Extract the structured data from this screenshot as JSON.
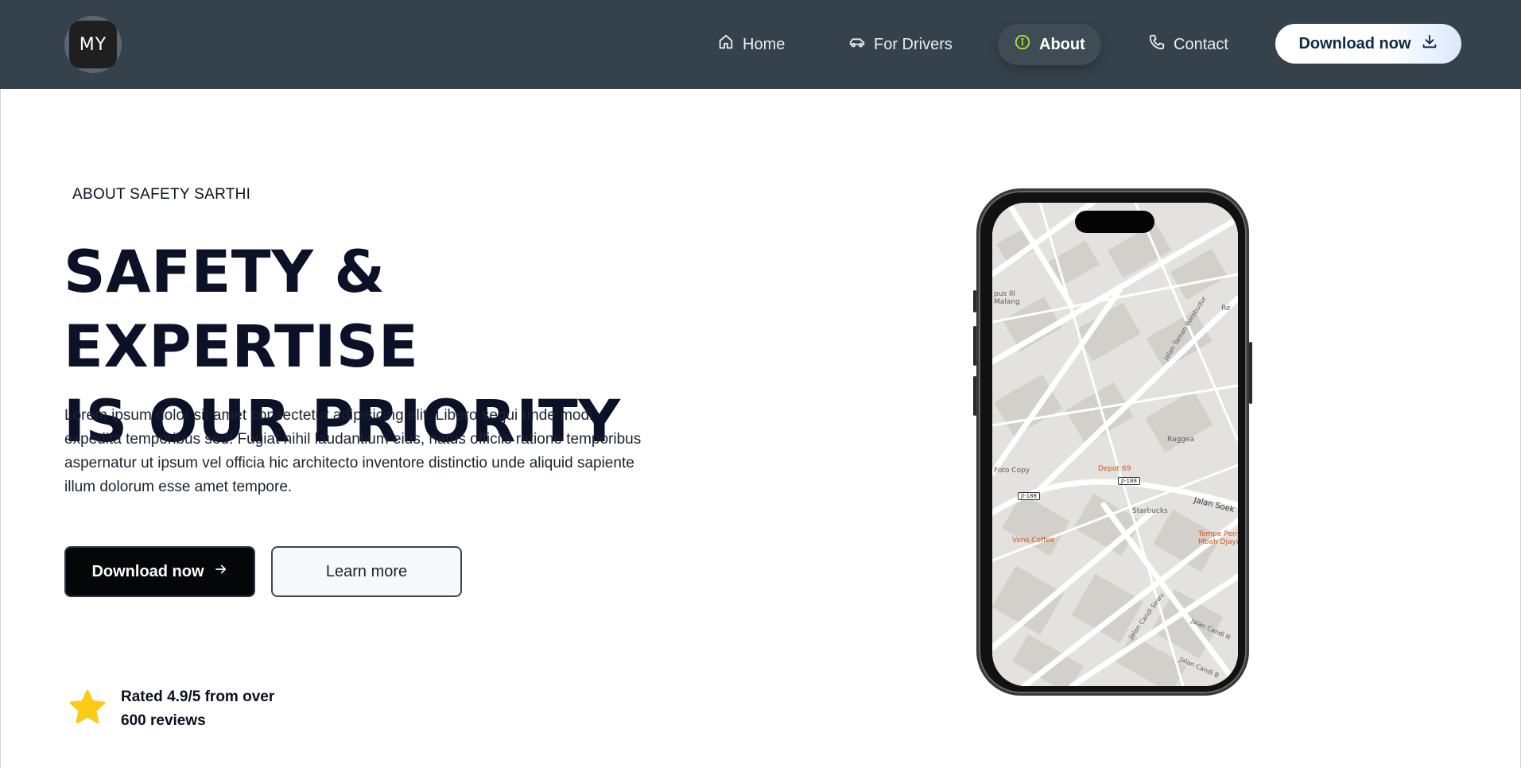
{
  "brand": {
    "logo_text": "MY"
  },
  "nav": {
    "items": [
      {
        "label": "Home",
        "icon": "home-icon"
      },
      {
        "label": "For Drivers",
        "icon": "car-icon"
      },
      {
        "label": "About",
        "icon": "info-icon",
        "active": true
      },
      {
        "label": "Contact",
        "icon": "phone-icon"
      }
    ],
    "download_label": "Download now"
  },
  "hero": {
    "eyebrow": "ABOUT SAFETY SARTHI",
    "headline_line1": "SAFETY & EXPERTISE",
    "headline_line2": "IS OUR PRIORITY",
    "body": "Lorem ipsum dolor sit amet consectetur adipisicing elit. Libero sequi unde modi expedita temporibus sed! Fugiat nihil laudantium eius, natus officiis ratione temporibus aspernatur ut ipsum vel officia hic architecto inventore distinctio unde aliquid sapiente illum dolorum esse amet tempore.",
    "primary_button": "Download now",
    "secondary_button": "Learn more"
  },
  "rating": {
    "line1": "Rated 4.9/5 from over",
    "line2": "600 reviews"
  },
  "map": {
    "labels": {
      "campus": "pus III\nMalang",
      "foto_copy": "Foto Copy",
      "depot": "Depot 69",
      "raggea": "Raggea",
      "starbucks": "Starbucks",
      "vens": "Vens Coffee",
      "tempe": "Tempe Peny\nMbah Djayu",
      "borobudur": "Jalan Taman Borobudur",
      "soek": "Jalan Soek",
      "candi_sewu": "Jalan Candi Sewu",
      "candi_n": "Jalan Candi N",
      "candi_b": "Jalan Candi B",
      "re": "Re",
      "road1": "Jl-188",
      "road2": "Jl-188"
    }
  },
  "colors": {
    "navbar": "#36424b",
    "accent_info": "#a3e635",
    "star": "#facc15"
  }
}
